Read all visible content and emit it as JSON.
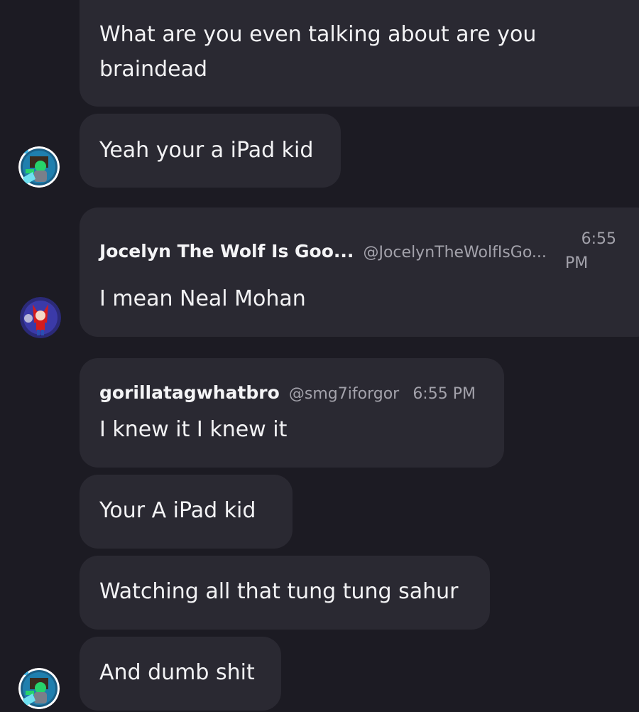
{
  "messages": [
    {
      "text_line1": "What are you even talking about are you",
      "text_line2": "braindead"
    },
    {
      "text": "Yeah your a iPad kid"
    },
    {
      "author": "Jocelyn The Wolf Is Goo...",
      "handle": "@JocelynTheWolfIsGo...",
      "time_line1": "6:55",
      "time_line2": "PM",
      "text": "I mean  Neal Mohan"
    },
    {
      "author": "gorillatagwhatbro",
      "handle": "@smg7iforgor",
      "time": "6:55 PM",
      "text": "I knew it I knew it"
    },
    {
      "text": "Your A  iPad kid"
    },
    {
      "text": "Watching all that tung tung sahur"
    },
    {
      "text": "And dumb shit"
    }
  ],
  "avatars": [
    {
      "icon": "cartoon-character-avatar"
    },
    {
      "icon": "anime-wolf-girl-avatar"
    },
    {
      "icon": "cartoon-character-avatar"
    }
  ],
  "colors": {
    "background": "#1c1b23",
    "bubble": "#2a2932",
    "text": "#f2f2f4",
    "muted": "#a3a2ab"
  }
}
